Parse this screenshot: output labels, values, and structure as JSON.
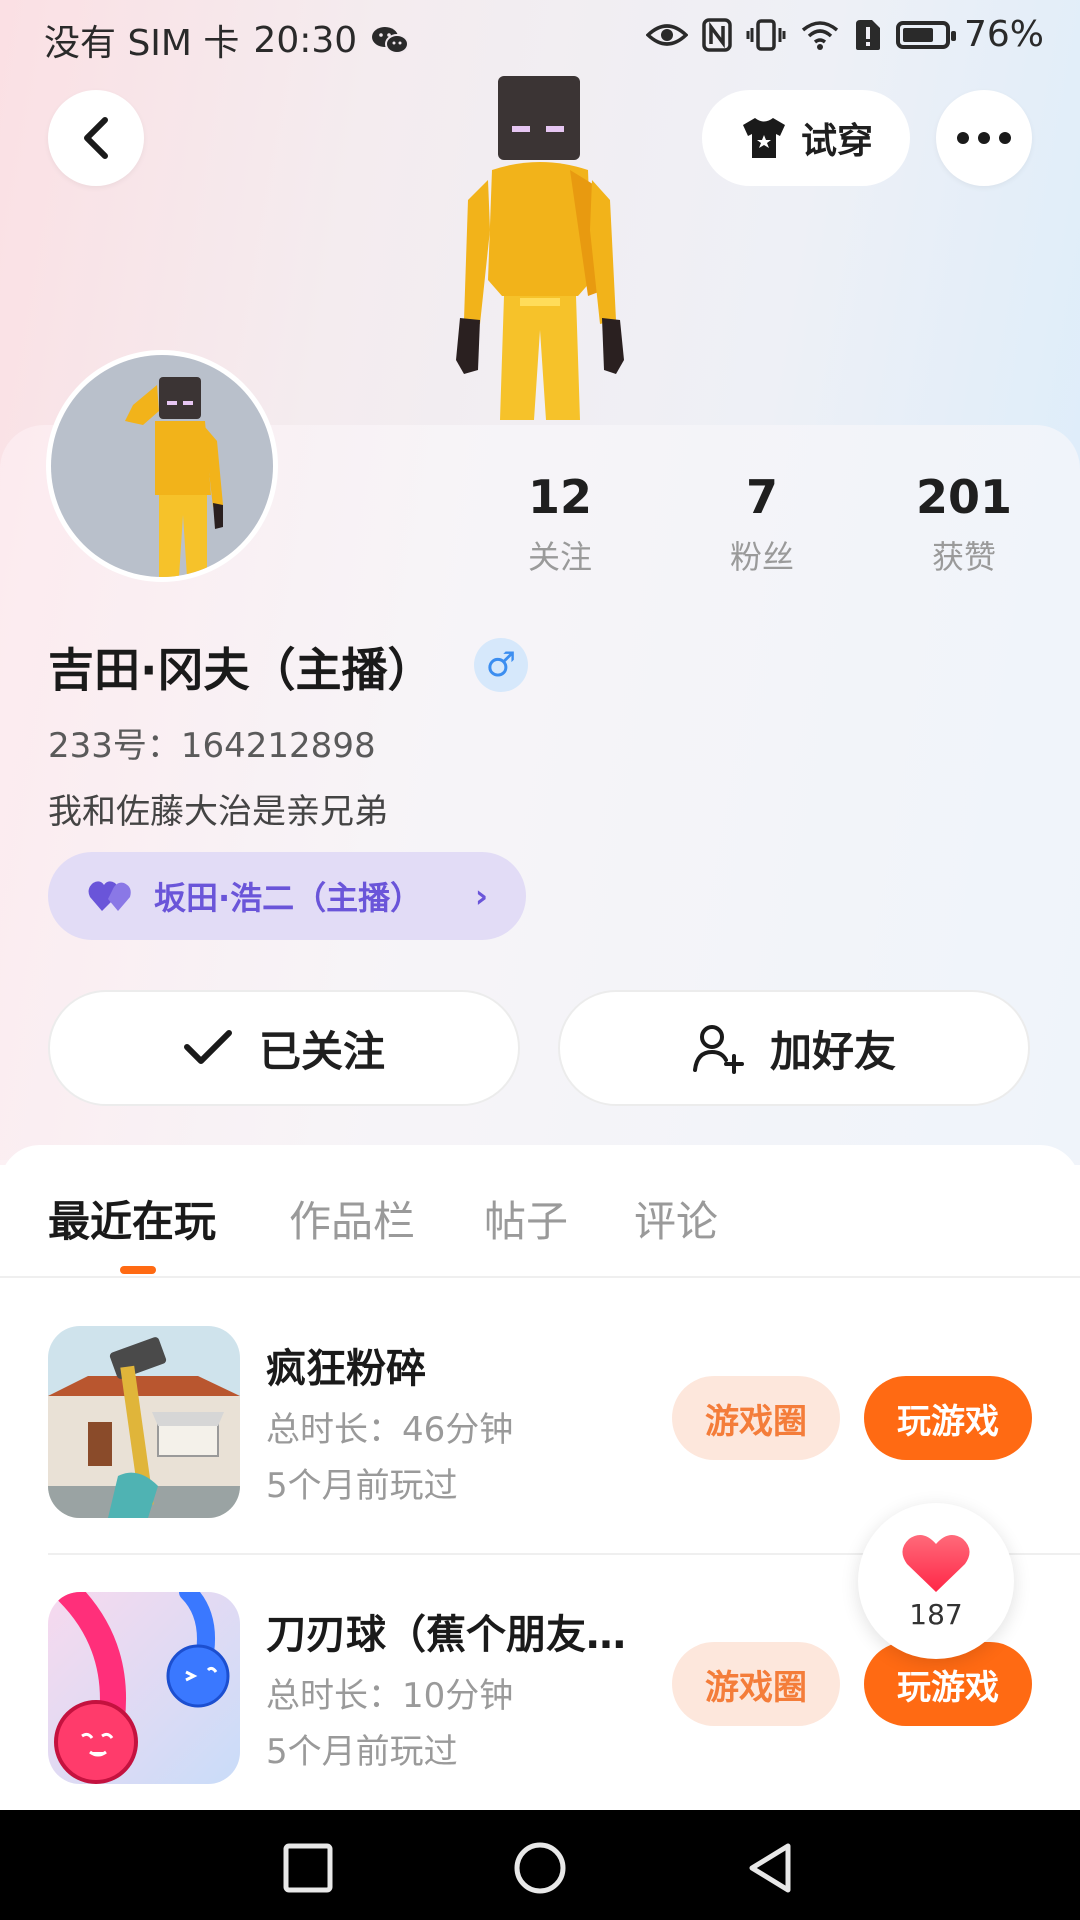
{
  "status_bar": {
    "carrier": "没有 SIM 卡",
    "time": "20:30",
    "battery_percent_text": "76%",
    "battery_level": 0.76
  },
  "top": {
    "try_on_label": "试穿"
  },
  "profile": {
    "name": "吉田·冈夫（主播）",
    "gender_symbol": "♂",
    "id_text": "233号：164212898",
    "bio": "我和佐藤大治是亲兄弟",
    "cp_name": "坂田·浩二（主播）",
    "cp_arrow": "›"
  },
  "stats": [
    {
      "value": "12",
      "label": "关注"
    },
    {
      "value": "7",
      "label": "粉丝"
    },
    {
      "value": "201",
      "label": "获赞"
    }
  ],
  "actions": {
    "followed_label": "已关注",
    "add_friend_label": "加好友"
  },
  "tabs": [
    {
      "label": "最近在玩",
      "active": true
    },
    {
      "label": "作品栏",
      "active": false
    },
    {
      "label": "帖子",
      "active": false
    },
    {
      "label": "评论",
      "active": false
    }
  ],
  "games": [
    {
      "title": "疯狂粉碎",
      "duration": "总时长：46分钟",
      "last_played": "5个月前玩过",
      "circle_label": "游戏圈",
      "play_label": "玩游戏"
    },
    {
      "title": "刀刃球（蕉个朋友…",
      "duration": "总时长：10分钟",
      "last_played": "5个月前玩过",
      "circle_label": "游戏圈",
      "play_label": "玩游戏"
    }
  ],
  "like_float": {
    "count": "187"
  },
  "colors": {
    "accent": "#ff6a13",
    "accent_light": "#fde7dc",
    "cp_bg": "#e2dcf6",
    "cp_text": "#6a55d9",
    "gender_blue": "#3c8ef0"
  }
}
